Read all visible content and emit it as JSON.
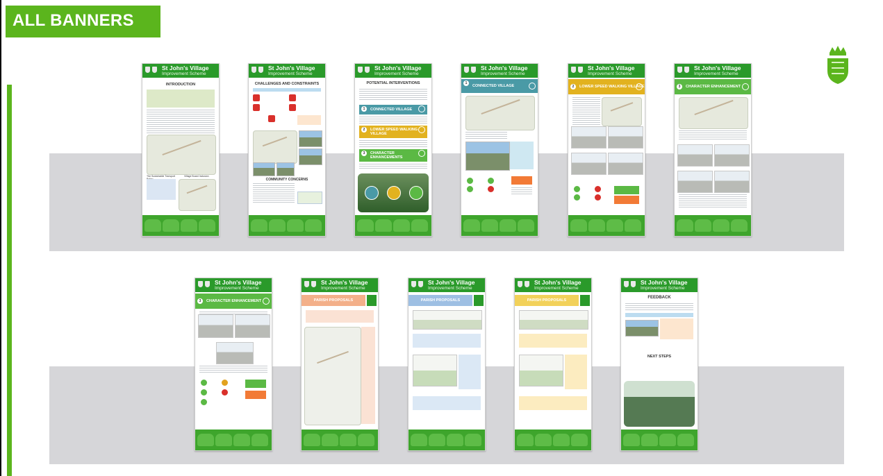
{
  "page": {
    "title": "ALL BANNERS",
    "accent_color": "#5bb51d"
  },
  "crest_icon": "crest-icon",
  "banner_header": {
    "title": "St John's Village",
    "subtitle": "Improvement Scheme"
  },
  "banners": [
    {
      "heading": "INTRODUCTION",
      "sub": "The Sustainable Transport Policy",
      "sub2": "Village Board Inclusion"
    },
    {
      "heading": "CHALLENGES AND CONSTRAINTS",
      "sub": "COMMUNITY CONCERNS"
    },
    {
      "heading": "POTENTIAL INTERVENTIONS",
      "items": [
        "CONNECTED VILLAGE",
        "LOWER SPEED WALKING VILLAGE",
        "CHARACTER ENHANCEMENTS"
      ],
      "numbers": [
        "1",
        "2",
        "3"
      ]
    },
    {
      "heading": "CONNECTED VILLAGE",
      "number": "1",
      "color": "#4a9aa6"
    },
    {
      "heading": "LOWER SPEED WALKING VILLAGE",
      "number": "2",
      "color": "#e2b21f"
    },
    {
      "heading": "CHARACTER ENHANCEMENT",
      "number": "3",
      "color": "#5bb944"
    },
    {
      "heading": "CHARACTER ENHANCEMENT",
      "number": "3",
      "color": "#5bb944"
    },
    {
      "heading": "PARISH PROPOSALS",
      "color": "#f3b08a"
    },
    {
      "heading": "PARISH PROPOSALS",
      "color": "#9ebfe3"
    },
    {
      "heading": "PARISH PROPOSALS",
      "color": "#f2d15a"
    },
    {
      "heading": "FEEDBACK",
      "sub": "NEXT STEPS"
    }
  ]
}
